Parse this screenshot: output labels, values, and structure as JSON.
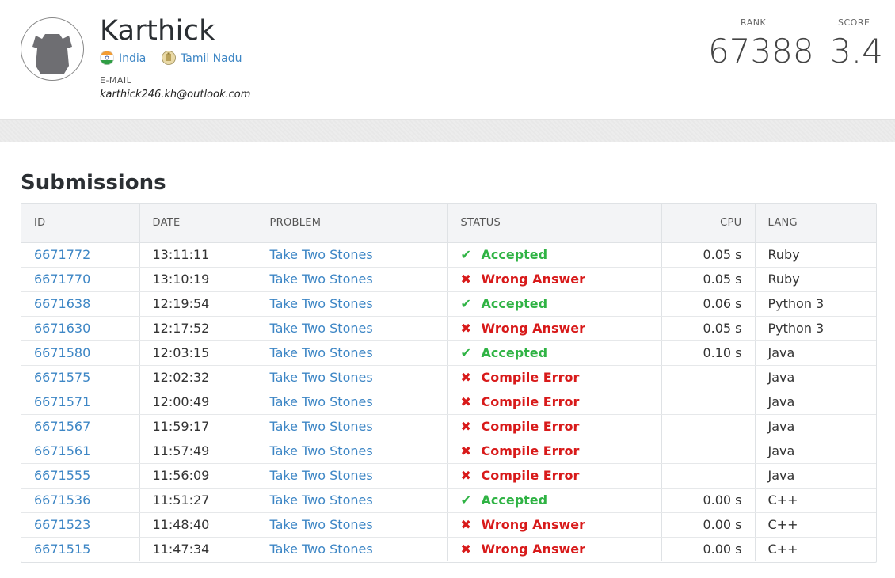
{
  "profile": {
    "name": "Karthick",
    "country": "India",
    "region": "Tamil Nadu",
    "email_label": "E-MAIL",
    "email": "karthick246.kh@outlook.com"
  },
  "stats": {
    "rank_label": "RANK",
    "rank": "67388",
    "score_label": "SCORE",
    "score": "3.4"
  },
  "submissions": {
    "title": "Submissions",
    "columns": [
      "ID",
      "DATE",
      "PROBLEM",
      "STATUS",
      "CPU",
      "LANG"
    ],
    "rows": [
      {
        "id": "6671772",
        "date": "13:11:11",
        "problem": "Take Two Stones",
        "status": "Accepted",
        "ok": true,
        "cpu": "0.05 s",
        "lang": "Ruby"
      },
      {
        "id": "6671770",
        "date": "13:10:19",
        "problem": "Take Two Stones",
        "status": "Wrong Answer",
        "ok": false,
        "cpu": "0.05 s",
        "lang": "Ruby"
      },
      {
        "id": "6671638",
        "date": "12:19:54",
        "problem": "Take Two Stones",
        "status": "Accepted",
        "ok": true,
        "cpu": "0.06 s",
        "lang": "Python 3"
      },
      {
        "id": "6671630",
        "date": "12:17:52",
        "problem": "Take Two Stones",
        "status": "Wrong Answer",
        "ok": false,
        "cpu": "0.05 s",
        "lang": "Python 3"
      },
      {
        "id": "6671580",
        "date": "12:03:15",
        "problem": "Take Two Stones",
        "status": "Accepted",
        "ok": true,
        "cpu": "0.10 s",
        "lang": "Java"
      },
      {
        "id": "6671575",
        "date": "12:02:32",
        "problem": "Take Two Stones",
        "status": "Compile Error",
        "ok": false,
        "cpu": "",
        "lang": "Java"
      },
      {
        "id": "6671571",
        "date": "12:00:49",
        "problem": "Take Two Stones",
        "status": "Compile Error",
        "ok": false,
        "cpu": "",
        "lang": "Java"
      },
      {
        "id": "6671567",
        "date": "11:59:17",
        "problem": "Take Two Stones",
        "status": "Compile Error",
        "ok": false,
        "cpu": "",
        "lang": "Java"
      },
      {
        "id": "6671561",
        "date": "11:57:49",
        "problem": "Take Two Stones",
        "status": "Compile Error",
        "ok": false,
        "cpu": "",
        "lang": "Java"
      },
      {
        "id": "6671555",
        "date": "11:56:09",
        "problem": "Take Two Stones",
        "status": "Compile Error",
        "ok": false,
        "cpu": "",
        "lang": "Java"
      },
      {
        "id": "6671536",
        "date": "11:51:27",
        "problem": "Take Two Stones",
        "status": "Accepted",
        "ok": true,
        "cpu": "0.00 s",
        "lang": "C++"
      },
      {
        "id": "6671523",
        "date": "11:48:40",
        "problem": "Take Two Stones",
        "status": "Wrong Answer",
        "ok": false,
        "cpu": "0.00 s",
        "lang": "C++"
      },
      {
        "id": "6671515",
        "date": "11:47:34",
        "problem": "Take Two Stones",
        "status": "Wrong Answer",
        "ok": false,
        "cpu": "0.00 s",
        "lang": "C++"
      }
    ]
  },
  "icons": {
    "ok": "check-icon",
    "bad": "cross-icon"
  },
  "colors": {
    "link": "#3d86c5",
    "accepted": "#2fb344",
    "error": "#d81a1a"
  }
}
